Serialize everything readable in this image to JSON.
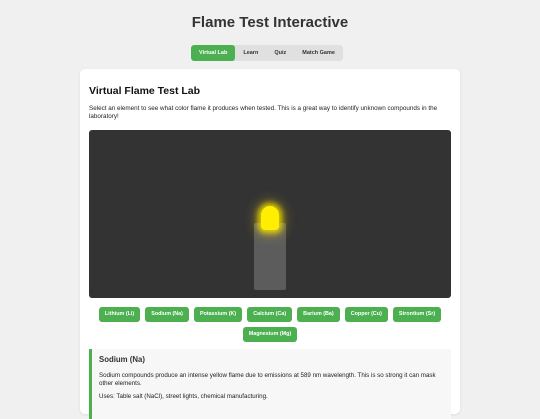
{
  "app": {
    "title": "Flame Test Interactive"
  },
  "tabs": [
    {
      "label": "Virtual Lab",
      "active": true
    },
    {
      "label": "Learn",
      "active": false
    },
    {
      "label": "Quiz",
      "active": false
    },
    {
      "label": "Match Game",
      "active": false
    }
  ],
  "lab": {
    "heading": "Virtual Flame Test Lab",
    "description": "Select an element to see what color flame it produces when tested. This is a great way to identify unknown compounds in the laboratory!",
    "flame_color": "#ffee00",
    "accent_color": "#4caf50"
  },
  "elements": [
    {
      "label": "Lithium (Li)"
    },
    {
      "label": "Sodium (Na)"
    },
    {
      "label": "Potassium (K)"
    },
    {
      "label": "Calcium (Ca)"
    },
    {
      "label": "Barium (Ba)"
    },
    {
      "label": "Copper (Cu)"
    },
    {
      "label": "Strontium (Sr)"
    },
    {
      "label": "Magnesium (Mg)"
    }
  ],
  "info": {
    "title": "Sodium (Na)",
    "text": "Sodium compounds produce an intense yellow flame due to emissions at 589 nm wavelength. This is so strong it can mask other elements.",
    "uses": "Uses: Table salt (NaCl), street lights, chemical manufacturing."
  }
}
